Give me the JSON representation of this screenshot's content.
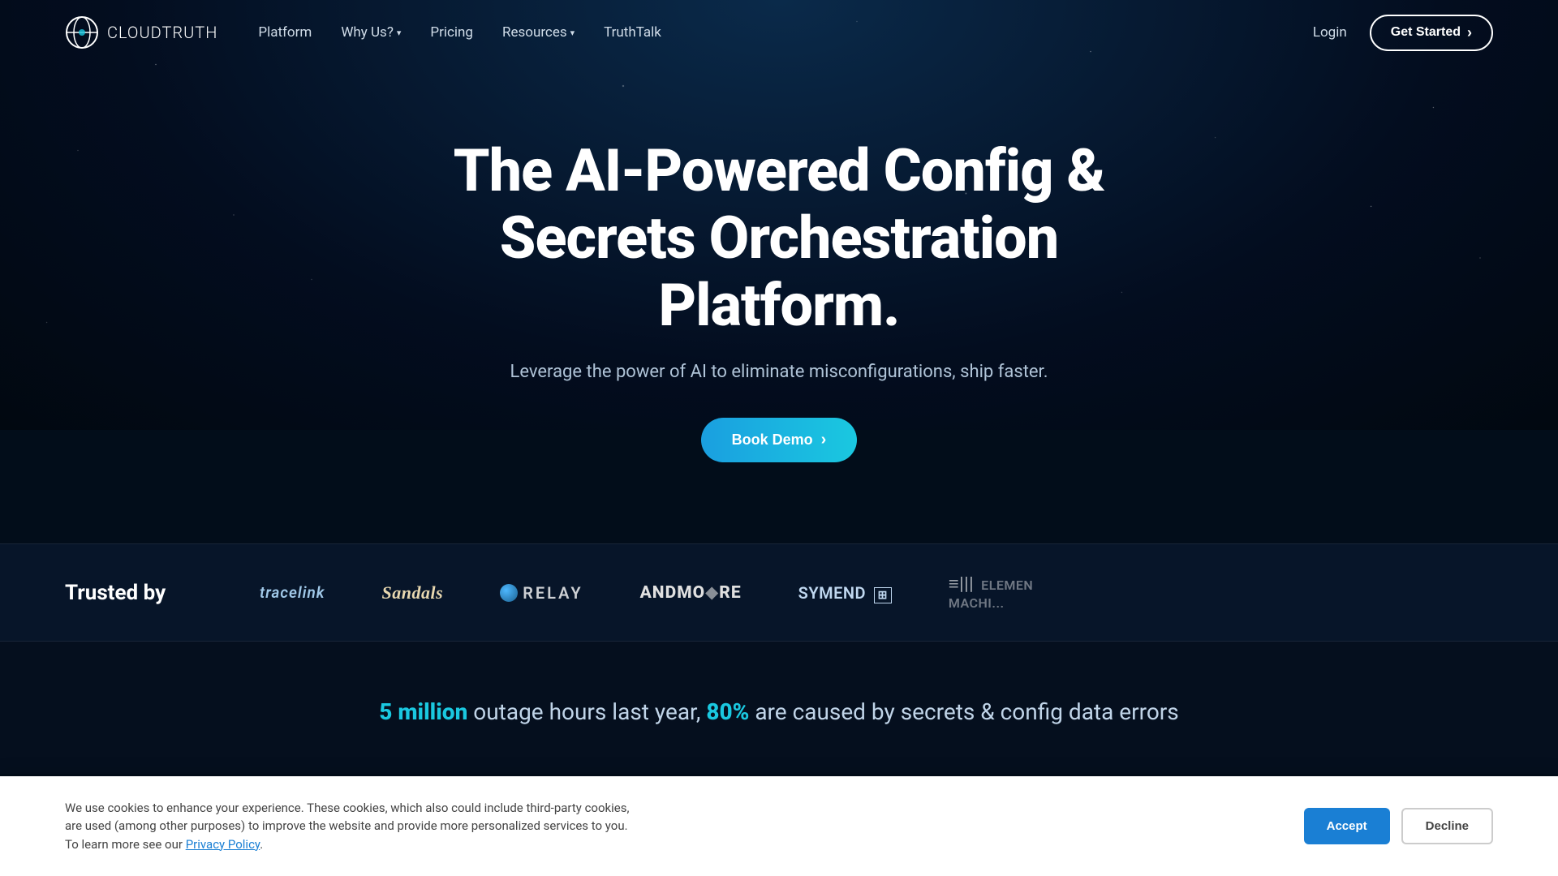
{
  "brand": {
    "name": "CLOUDTRUTH",
    "name_light": "CLOUD",
    "name_bold": "TRUTH"
  },
  "nav": {
    "links": [
      {
        "label": "Platform",
        "has_dropdown": false
      },
      {
        "label": "Why Us?",
        "has_dropdown": true
      },
      {
        "label": "Pricing",
        "has_dropdown": false
      },
      {
        "label": "Resources",
        "has_dropdown": true
      },
      {
        "label": "TruthTalk",
        "has_dropdown": false
      }
    ],
    "login_label": "Login",
    "cta_label": "Get Started",
    "cta_arrow": "›"
  },
  "hero": {
    "heading": "The AI-Powered Config & Secrets Orchestration Platform.",
    "subheading": "Leverage the power of AI to eliminate misconfigurations, ship faster.",
    "cta_label": "Book Demo",
    "cta_arrow": "›"
  },
  "trusted": {
    "label": "Trusted by",
    "logos": [
      {
        "name": "tracelink",
        "text": "tracelink",
        "class": "tracelink"
      },
      {
        "name": "sandals",
        "text": "Sandals",
        "class": "sandals"
      },
      {
        "name": "relay",
        "text": "RELAY",
        "class": "relay"
      },
      {
        "name": "andmore",
        "text": "ANDMO RE",
        "class": "andmore"
      },
      {
        "name": "symend",
        "text": "SYMEND",
        "class": "symend"
      },
      {
        "name": "elementmachine",
        "text": "≡||| ELEMEN MACHI...",
        "class": "elementmachine"
      }
    ]
  },
  "stats": {
    "highlight1": "5 million",
    "text1": " outage hours last year, ",
    "highlight2": "80%",
    "text2": " are caused by secrets & config data errors"
  },
  "cookie": {
    "message": "We use cookies to enhance your experience. These cookies, which also could include third-party cookies, are used (among other purposes) to improve the website and provide more personalized services to you. To learn more see our ",
    "link_text": "Privacy Policy",
    "accept_label": "Accept",
    "decline_label": "Decline"
  }
}
